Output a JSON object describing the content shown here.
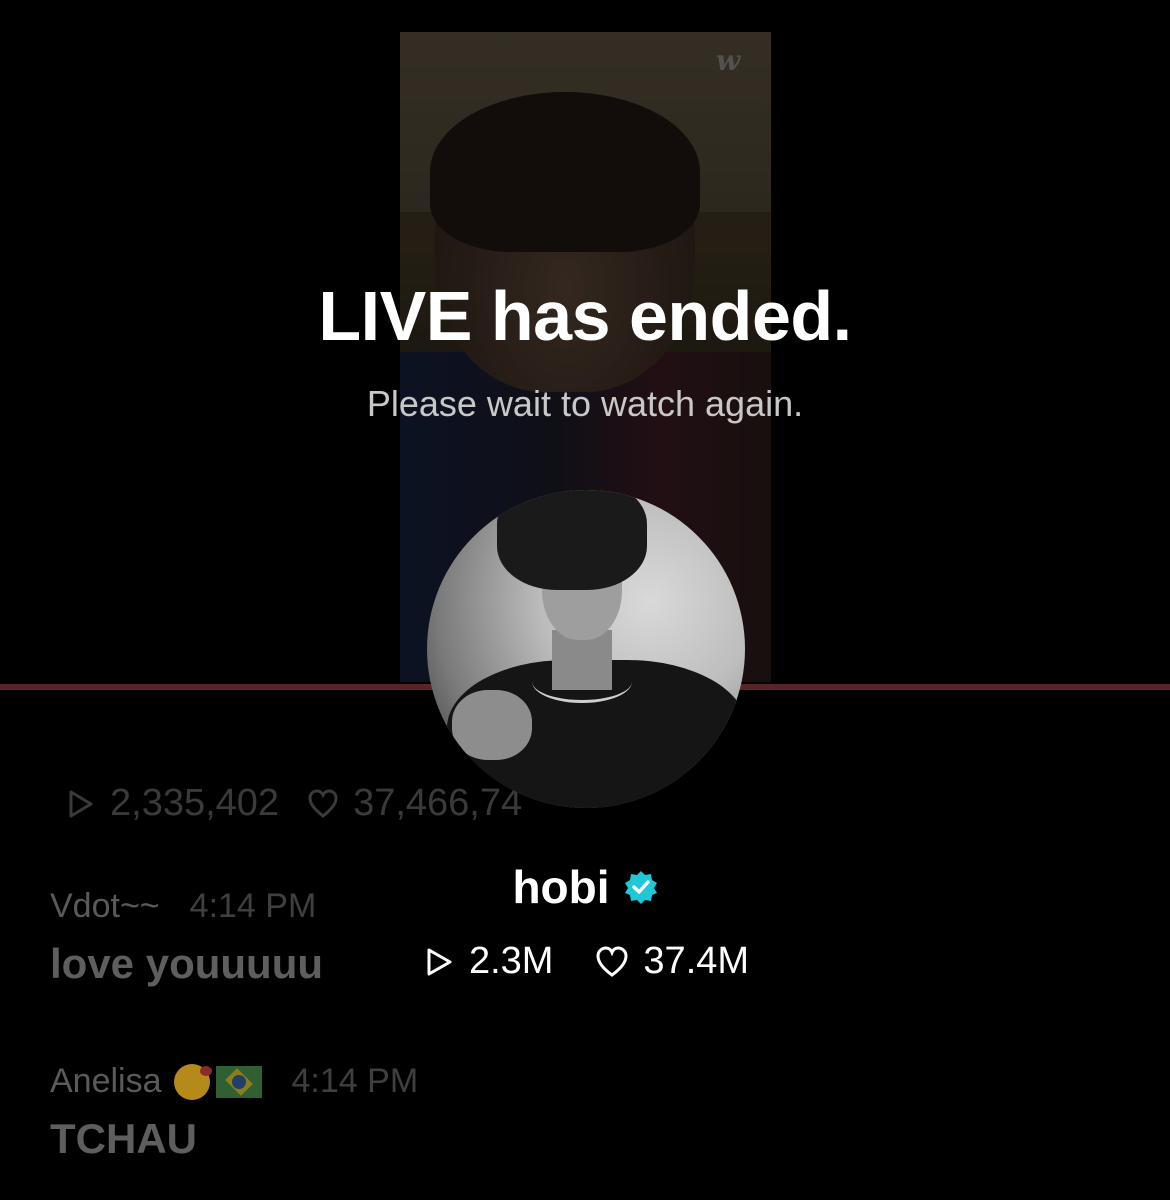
{
  "live_ended": {
    "title": "LIVE has ended.",
    "subtitle": "Please wait to watch again."
  },
  "watermark": {
    "icon": "weverse-w-icon",
    "text": "w"
  },
  "background_stats": {
    "plays": "2,335,402",
    "likes": "37,466,74"
  },
  "chat": [
    {
      "user": "Vdot~~",
      "time": "4:14 PM",
      "message": "love youuuuu"
    },
    {
      "user": "Anelisa",
      "time": "4:14 PM",
      "message": "TCHAU"
    }
  ],
  "profile": {
    "name": "hobi",
    "verified_color": "#1fc8d6",
    "plays": "2.3M",
    "likes": "37.4M"
  }
}
